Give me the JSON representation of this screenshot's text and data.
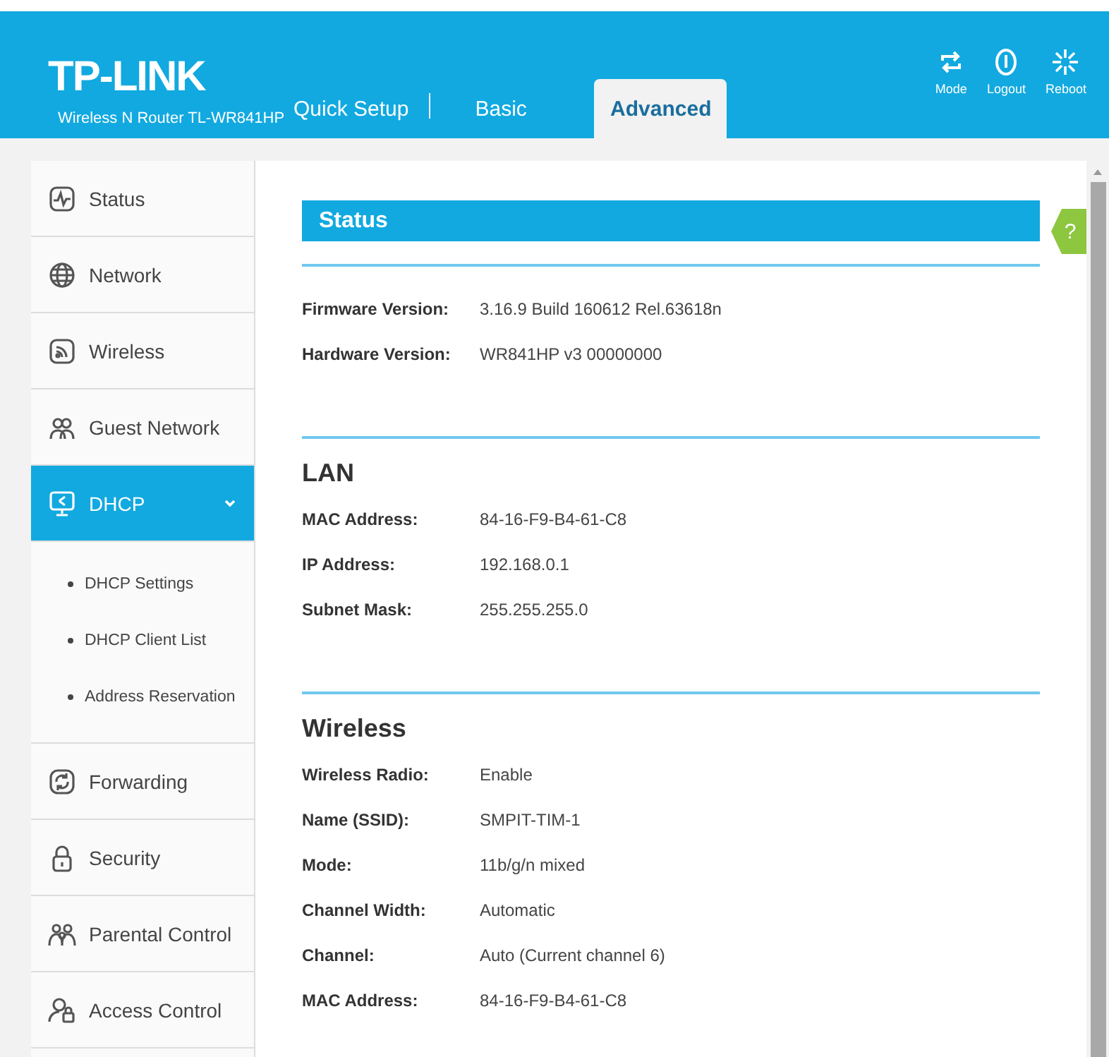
{
  "header": {
    "logo": "TP-LINK",
    "model": "Wireless N Router TL-WR841HP",
    "tabs": [
      {
        "label": "Quick Setup",
        "selected": false
      },
      {
        "label": "Basic",
        "selected": false
      },
      {
        "label": "Advanced",
        "selected": true
      }
    ],
    "actions": [
      {
        "label": "Mode"
      },
      {
        "label": "Logout"
      },
      {
        "label": "Reboot"
      }
    ]
  },
  "sidebar": {
    "items": [
      {
        "label": "Status",
        "selected": false
      },
      {
        "label": "Network",
        "selected": false
      },
      {
        "label": "Wireless",
        "selected": false
      },
      {
        "label": "Guest Network",
        "selected": false
      },
      {
        "label": "DHCP",
        "selected": true,
        "expanded": true,
        "children": [
          {
            "label": "DHCP Settings"
          },
          {
            "label": "DHCP Client List"
          },
          {
            "label": "Address Reservation"
          }
        ]
      },
      {
        "label": "Forwarding",
        "selected": false
      },
      {
        "label": "Security",
        "selected": false
      },
      {
        "label": "Parental Control",
        "selected": false
      },
      {
        "label": "Access Control",
        "selected": false
      }
    ]
  },
  "content": {
    "title": "Status",
    "help": "?",
    "sections": [
      {
        "rows": [
          {
            "label": "Firmware Version:",
            "value": "3.16.9 Build 160612 Rel.63618n"
          },
          {
            "label": "Hardware Version:",
            "value": "WR841HP v3 00000000"
          }
        ]
      },
      {
        "heading": "LAN",
        "rows": [
          {
            "label": "MAC Address:",
            "value": "84-16-F9-B4-61-C8"
          },
          {
            "label": "IP Address:",
            "value": "192.168.0.1"
          },
          {
            "label": "Subnet Mask:",
            "value": "255.255.255.0"
          }
        ]
      },
      {
        "heading": "Wireless",
        "rows": [
          {
            "label": "Wireless Radio:",
            "value": "Enable"
          },
          {
            "label": "Name (SSID):",
            "value": "SMPIT-TIM-1"
          },
          {
            "label": "Mode:",
            "value": "11b/g/n mixed"
          },
          {
            "label": "Channel Width:",
            "value": "Automatic"
          },
          {
            "label": "Channel:",
            "value": "Auto (Current channel 6)"
          },
          {
            "label": "MAC Address:",
            "value": "84-16-F9-B4-61-C8"
          }
        ]
      }
    ]
  }
}
